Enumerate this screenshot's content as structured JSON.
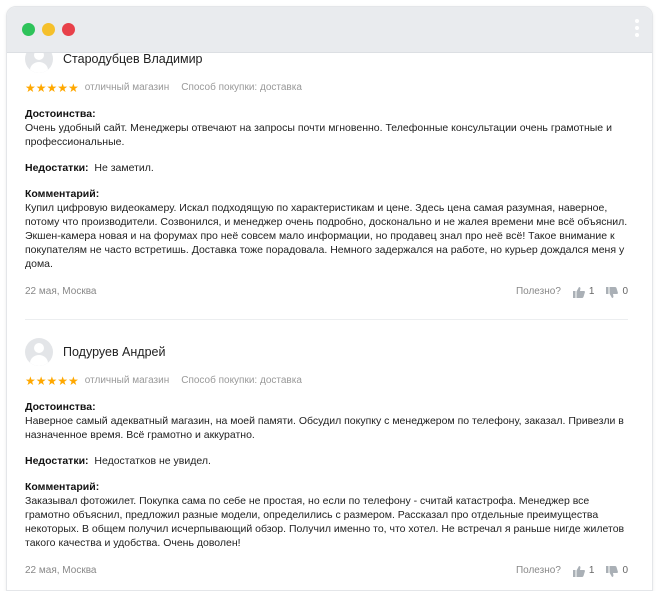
{
  "window": {
    "colors": {
      "green": "#2ec35a",
      "yellow": "#f5c02b",
      "red": "#e8414a",
      "menu_icon": "menu-dots-icon"
    }
  },
  "reviews": [
    {
      "author": "Стародубцев Владимир",
      "stars": "★★★★★",
      "rating": 5,
      "rating_label": "отличный магазин",
      "purchase_method": "Способ покупки: доставка",
      "pros_label": "Достоинства:",
      "pros_text": "Очень удобный сайт. Менеджеры отвечают на запросы почти мгновенно. Телефонные консультации очень грамотные и профессиональные.",
      "cons_label": "Недостатки:",
      "cons_text": "Не заметил.",
      "comment_label": "Комментарий:",
      "comment_text": "Купил цифровую видеокамеру. Искал подходящую по характеристикам и цене. Здесь цена самая разумная, наверное, потому что производители. Созвонился, и менеджер очень подробно, досконально и не жалея времени мне всё объяснил. Экшен-камера новая и на форумах про неё совсем мало информации, но продавец знал про неё всё! Такое внимание к покупателям не часто встретишь. Доставка тоже порадовала. Немного задержался на работе, но курьер дождался меня у дома.",
      "date_location": "22 мая, Москва",
      "helpful_label": "Полезно?",
      "likes": "1",
      "dislikes": "0"
    },
    {
      "author": "Подуруев Андрей",
      "stars": "★★★★★",
      "rating": 5,
      "rating_label": "отличный магазин",
      "purchase_method": "Способ покупки: доставка",
      "pros_label": "Достоинства:",
      "pros_text": "Наверное самый адекватный магазин, на моей памяти. Обсудил покупку с менеджером по телефону, заказал. Привезли в назначенное время. Всё грамотно и аккуратно.",
      "cons_label": "Недостатки:",
      "cons_text": "Недостатков не увидел.",
      "comment_label": "Комментарий:",
      "comment_text": "Заказывал фотожилет. Покупка сама по себе не простая, но если по телефону - считай катастрофа. Менеджер все грамотно объяснил, предложил разные модели, определились с размером. Рассказал про отдельные преимущества некоторых. В общем получил исчерпывающий обзор. Получил именно то, что хотел. Не встречал я раньше нигде жилетов такого качества и удобства. Очень доволен!",
      "date_location": "22 мая, Москва",
      "helpful_label": "Полезно?",
      "likes": "1",
      "dislikes": "0"
    }
  ]
}
